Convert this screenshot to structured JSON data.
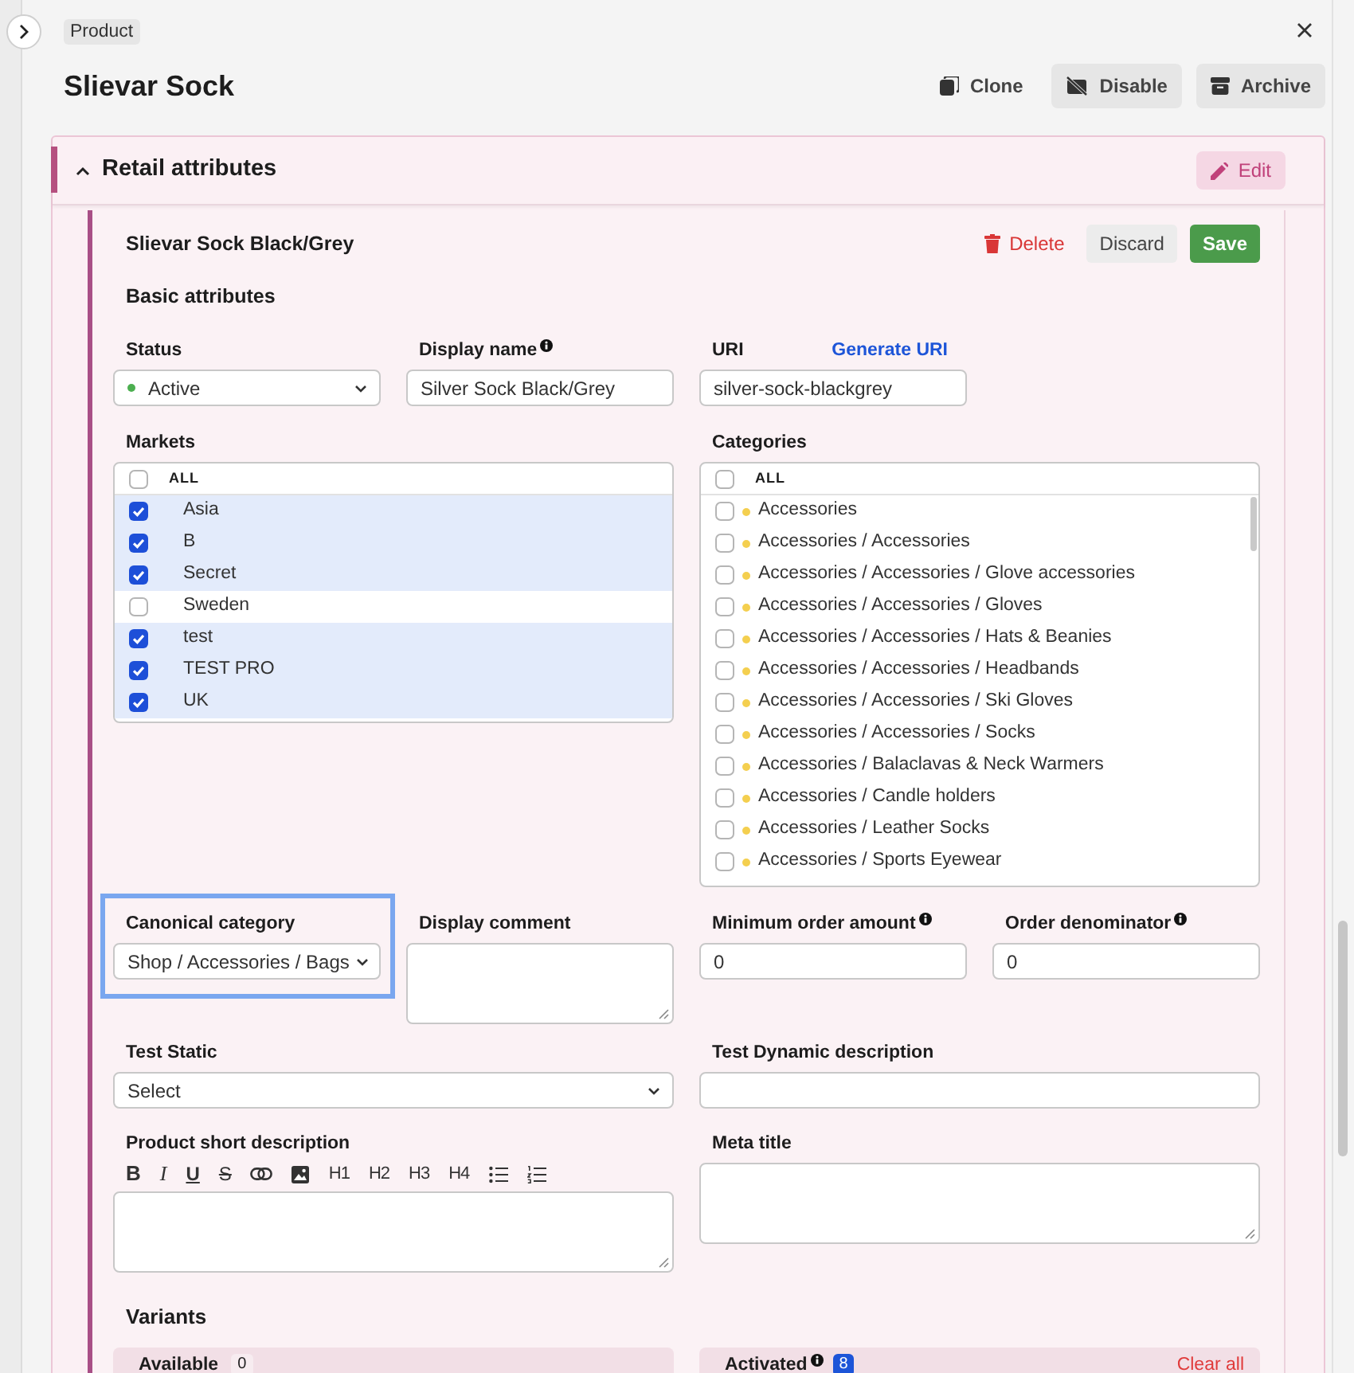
{
  "header": {
    "badge": "Product",
    "title": "Slievar Sock",
    "actions": [
      {
        "kind": "clone",
        "label": "Clone"
      },
      {
        "kind": "disable",
        "label": "Disable"
      },
      {
        "kind": "archive",
        "label": "Archive"
      }
    ]
  },
  "section": {
    "title": "Retail attributes",
    "expanded": true,
    "edit_label": "Edit"
  },
  "card": {
    "title": "Slievar Sock Black/Grey",
    "delete_label": "Delete",
    "discard_label": "Discard",
    "save_label": "Save",
    "subtitle": "Basic attributes"
  },
  "status": {
    "label": "Status",
    "value": "Active"
  },
  "display_name": {
    "label": "Display name",
    "value": "Silver Sock Black/Grey"
  },
  "uri": {
    "label": "URI",
    "link": "Generate URI",
    "value": "silver-sock-blackgrey"
  },
  "markets": {
    "label": "Markets",
    "all_label": "ALL",
    "all_checked": false,
    "items": [
      {
        "label": "Asia",
        "checked": true
      },
      {
        "label": "B",
        "checked": true
      },
      {
        "label": "Secret",
        "checked": true
      },
      {
        "label": "Sweden",
        "checked": false
      },
      {
        "label": "test",
        "checked": true
      },
      {
        "label": "TEST PRO",
        "checked": true
      },
      {
        "label": "UK",
        "checked": true
      }
    ]
  },
  "categories": {
    "label": "Categories",
    "all_label": "ALL",
    "all_checked": false,
    "items": [
      {
        "label": "Accessories",
        "checked": false
      },
      {
        "label": "Accessories / Accessories",
        "checked": false
      },
      {
        "label": "Accessories / Accessories / Glove accessories",
        "checked": false
      },
      {
        "label": "Accessories / Accessories / Gloves",
        "checked": false
      },
      {
        "label": "Accessories / Accessories / Hats & Beanies",
        "checked": false
      },
      {
        "label": "Accessories / Accessories / Headbands",
        "checked": false
      },
      {
        "label": "Accessories / Accessories / Ski Gloves",
        "checked": false
      },
      {
        "label": "Accessories / Accessories / Socks",
        "checked": false
      },
      {
        "label": "Accessories / Balaclavas & Neck Warmers",
        "checked": false
      },
      {
        "label": "Accessories / Candle holders",
        "checked": false
      },
      {
        "label": "Accessories / Leather Socks",
        "checked": false
      },
      {
        "label": "Accessories / Sports Eyewear",
        "checked": false
      }
    ]
  },
  "canonical_category": {
    "label": "Canonical category",
    "value": "Shop / Accessories / Bags",
    "focused": true
  },
  "display_comment": {
    "label": "Display comment"
  },
  "minimum_order_amount": {
    "label": "Minimum order amount",
    "value": "0"
  },
  "order_denominator": {
    "label": "Order denominator",
    "value": "0"
  },
  "test_static": {
    "label": "Test Static",
    "value": "Select"
  },
  "test_dynamic_description": {
    "label": "Test Dynamic description"
  },
  "product_short_description": {
    "label": "Product short description",
    "toolbar": [
      {
        "kind": "bold",
        "label": "B"
      },
      {
        "kind": "italic",
        "label": "I"
      },
      {
        "kind": "underline",
        "label": "U"
      },
      {
        "kind": "strike",
        "label": "S"
      },
      {
        "kind": "link"
      },
      {
        "kind": "image"
      },
      {
        "kind": "heading",
        "label": "H1"
      },
      {
        "kind": "heading",
        "label": "H2"
      },
      {
        "kind": "heading",
        "label": "H3"
      },
      {
        "kind": "heading",
        "label": "H4"
      },
      {
        "kind": "bullets"
      },
      {
        "kind": "numbers"
      }
    ]
  },
  "meta_title": {
    "label": "Meta title"
  },
  "variants": {
    "title": "Variants",
    "available": {
      "label": "Available",
      "count": "0"
    },
    "activated": {
      "label": "Activated",
      "count": "8",
      "clear_label": "Clear all"
    }
  }
}
